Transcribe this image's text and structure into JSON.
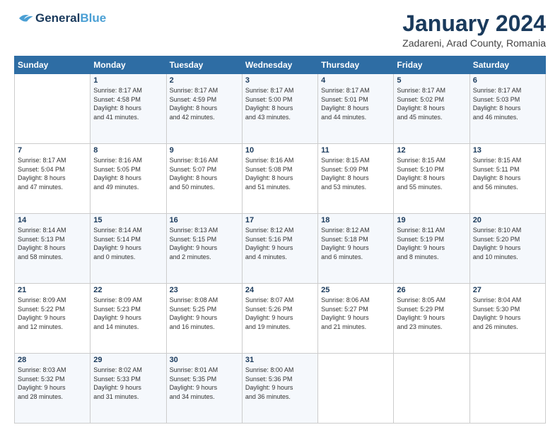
{
  "header": {
    "logo_general": "General",
    "logo_blue": "Blue",
    "title": "January 2024",
    "subtitle": "Zadareni, Arad County, Romania"
  },
  "days_of_week": [
    "Sunday",
    "Monday",
    "Tuesday",
    "Wednesday",
    "Thursday",
    "Friday",
    "Saturday"
  ],
  "weeks": [
    [
      {
        "num": "",
        "info": ""
      },
      {
        "num": "1",
        "info": "Sunrise: 8:17 AM\nSunset: 4:58 PM\nDaylight: 8 hours\nand 41 minutes."
      },
      {
        "num": "2",
        "info": "Sunrise: 8:17 AM\nSunset: 4:59 PM\nDaylight: 8 hours\nand 42 minutes."
      },
      {
        "num": "3",
        "info": "Sunrise: 8:17 AM\nSunset: 5:00 PM\nDaylight: 8 hours\nand 43 minutes."
      },
      {
        "num": "4",
        "info": "Sunrise: 8:17 AM\nSunset: 5:01 PM\nDaylight: 8 hours\nand 44 minutes."
      },
      {
        "num": "5",
        "info": "Sunrise: 8:17 AM\nSunset: 5:02 PM\nDaylight: 8 hours\nand 45 minutes."
      },
      {
        "num": "6",
        "info": "Sunrise: 8:17 AM\nSunset: 5:03 PM\nDaylight: 8 hours\nand 46 minutes."
      }
    ],
    [
      {
        "num": "7",
        "info": "Sunrise: 8:17 AM\nSunset: 5:04 PM\nDaylight: 8 hours\nand 47 minutes."
      },
      {
        "num": "8",
        "info": "Sunrise: 8:16 AM\nSunset: 5:05 PM\nDaylight: 8 hours\nand 49 minutes."
      },
      {
        "num": "9",
        "info": "Sunrise: 8:16 AM\nSunset: 5:07 PM\nDaylight: 8 hours\nand 50 minutes."
      },
      {
        "num": "10",
        "info": "Sunrise: 8:16 AM\nSunset: 5:08 PM\nDaylight: 8 hours\nand 51 minutes."
      },
      {
        "num": "11",
        "info": "Sunrise: 8:15 AM\nSunset: 5:09 PM\nDaylight: 8 hours\nand 53 minutes."
      },
      {
        "num": "12",
        "info": "Sunrise: 8:15 AM\nSunset: 5:10 PM\nDaylight: 8 hours\nand 55 minutes."
      },
      {
        "num": "13",
        "info": "Sunrise: 8:15 AM\nSunset: 5:11 PM\nDaylight: 8 hours\nand 56 minutes."
      }
    ],
    [
      {
        "num": "14",
        "info": "Sunrise: 8:14 AM\nSunset: 5:13 PM\nDaylight: 8 hours\nand 58 minutes."
      },
      {
        "num": "15",
        "info": "Sunrise: 8:14 AM\nSunset: 5:14 PM\nDaylight: 9 hours\nand 0 minutes."
      },
      {
        "num": "16",
        "info": "Sunrise: 8:13 AM\nSunset: 5:15 PM\nDaylight: 9 hours\nand 2 minutes."
      },
      {
        "num": "17",
        "info": "Sunrise: 8:12 AM\nSunset: 5:16 PM\nDaylight: 9 hours\nand 4 minutes."
      },
      {
        "num": "18",
        "info": "Sunrise: 8:12 AM\nSunset: 5:18 PM\nDaylight: 9 hours\nand 6 minutes."
      },
      {
        "num": "19",
        "info": "Sunrise: 8:11 AM\nSunset: 5:19 PM\nDaylight: 9 hours\nand 8 minutes."
      },
      {
        "num": "20",
        "info": "Sunrise: 8:10 AM\nSunset: 5:20 PM\nDaylight: 9 hours\nand 10 minutes."
      }
    ],
    [
      {
        "num": "21",
        "info": "Sunrise: 8:09 AM\nSunset: 5:22 PM\nDaylight: 9 hours\nand 12 minutes."
      },
      {
        "num": "22",
        "info": "Sunrise: 8:09 AM\nSunset: 5:23 PM\nDaylight: 9 hours\nand 14 minutes."
      },
      {
        "num": "23",
        "info": "Sunrise: 8:08 AM\nSunset: 5:25 PM\nDaylight: 9 hours\nand 16 minutes."
      },
      {
        "num": "24",
        "info": "Sunrise: 8:07 AM\nSunset: 5:26 PM\nDaylight: 9 hours\nand 19 minutes."
      },
      {
        "num": "25",
        "info": "Sunrise: 8:06 AM\nSunset: 5:27 PM\nDaylight: 9 hours\nand 21 minutes."
      },
      {
        "num": "26",
        "info": "Sunrise: 8:05 AM\nSunset: 5:29 PM\nDaylight: 9 hours\nand 23 minutes."
      },
      {
        "num": "27",
        "info": "Sunrise: 8:04 AM\nSunset: 5:30 PM\nDaylight: 9 hours\nand 26 minutes."
      }
    ],
    [
      {
        "num": "28",
        "info": "Sunrise: 8:03 AM\nSunset: 5:32 PM\nDaylight: 9 hours\nand 28 minutes."
      },
      {
        "num": "29",
        "info": "Sunrise: 8:02 AM\nSunset: 5:33 PM\nDaylight: 9 hours\nand 31 minutes."
      },
      {
        "num": "30",
        "info": "Sunrise: 8:01 AM\nSunset: 5:35 PM\nDaylight: 9 hours\nand 34 minutes."
      },
      {
        "num": "31",
        "info": "Sunrise: 8:00 AM\nSunset: 5:36 PM\nDaylight: 9 hours\nand 36 minutes."
      },
      {
        "num": "",
        "info": ""
      },
      {
        "num": "",
        "info": ""
      },
      {
        "num": "",
        "info": ""
      }
    ]
  ]
}
